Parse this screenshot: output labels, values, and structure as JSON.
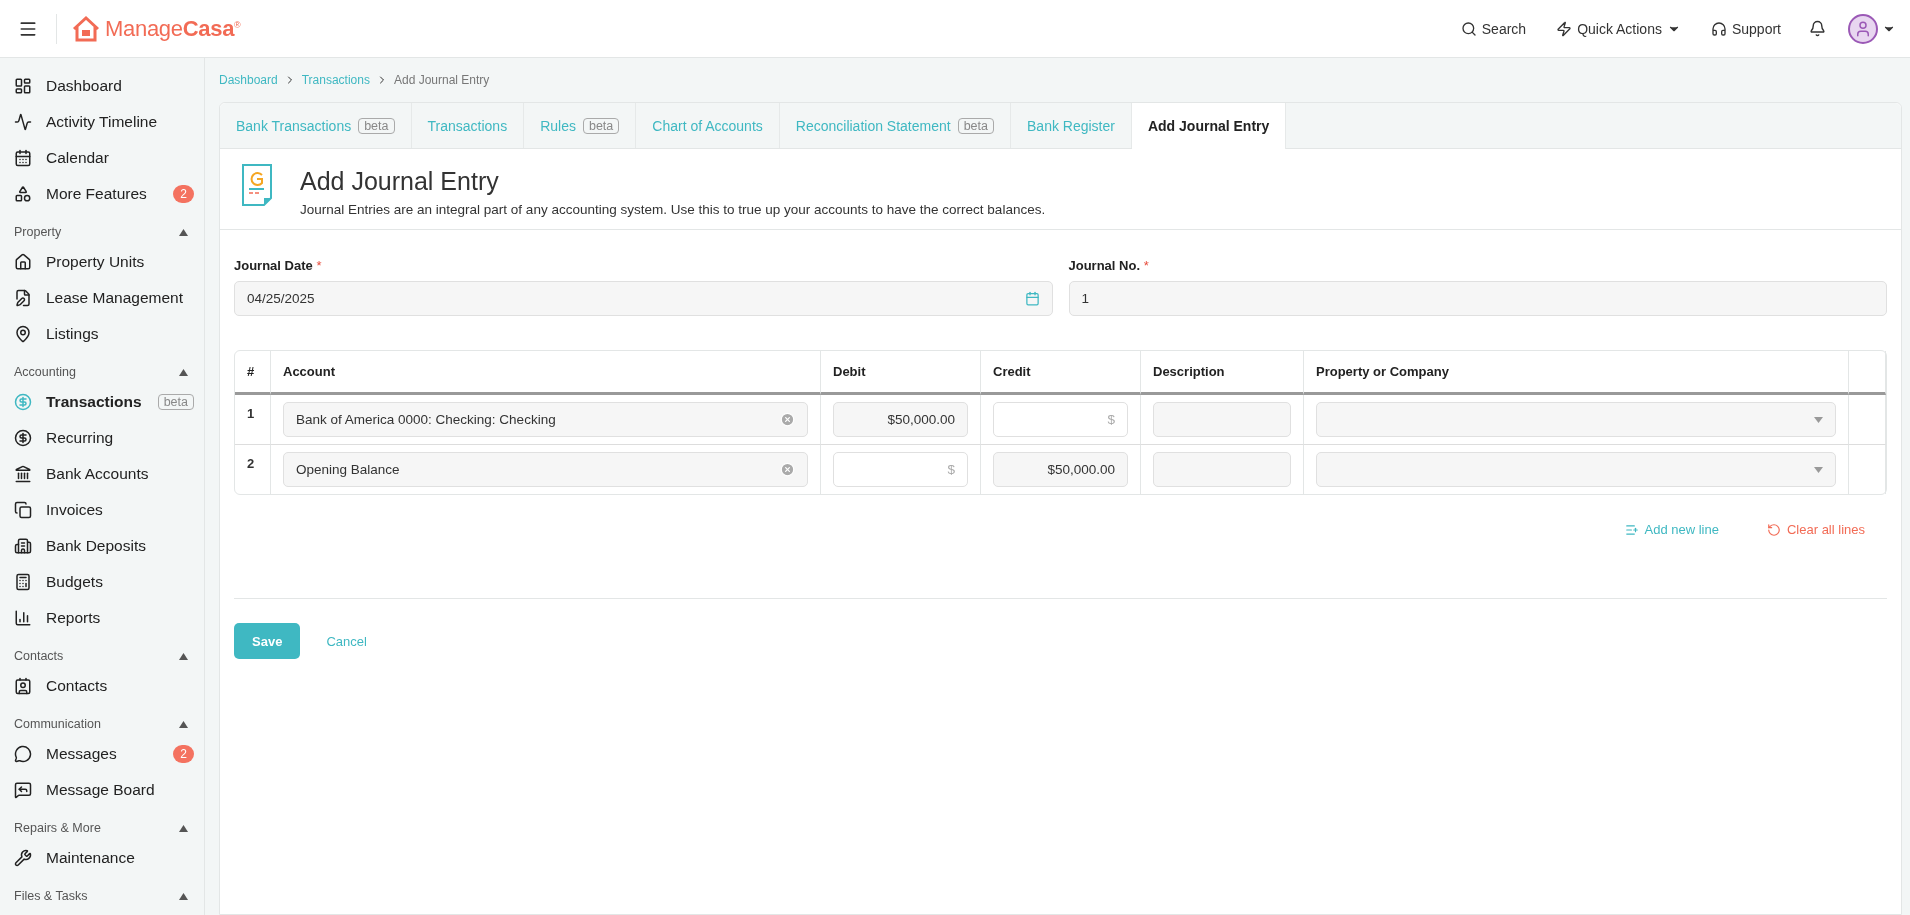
{
  "header": {
    "brand": "Manage**Casa**$^{®}$",
    "actions": [
      {
        "kind": "search",
        "label": "Search"
      },
      {
        "kind": "quick",
        "label": "Quick Actions"
      },
      {
        "kind": "support",
        "label": "Support"
      }
    ]
  },
  "sidebar": {
    "sections": [
      {
        "items": [
          {
            "label": "Dashboard",
            "selected": false
          },
          {
            "label": "Activity Timeline",
            "selected": false
          },
          {
            "label": "Calendar",
            "selected": false
          },
          {
            "label": "More Features",
            "badge": "2",
            "selected": false
          }
        ]
      },
      {
        "title": "Property",
        "expanded": true,
        "items": [
          {
            "label": "Property Units",
            "selected": false
          },
          {
            "label": "Lease Management",
            "selected": false
          },
          {
            "label": "Listings",
            "selected": false
          }
        ]
      },
      {
        "title": "Accounting",
        "expanded": true,
        "items": [
          {
            "label": "Transactions",
            "tag": "beta",
            "selected": true
          },
          {
            "label": "Recurring",
            "selected": false
          },
          {
            "label": "Bank Accounts",
            "selected": false
          },
          {
            "label": "Invoices",
            "selected": false
          },
          {
            "label": "Bank Deposits",
            "selected": false
          },
          {
            "label": "Budgets",
            "selected": false
          },
          {
            "label": "Reports",
            "selected": false
          }
        ]
      },
      {
        "title": "Contacts",
        "expanded": true,
        "items": [
          {
            "label": "Contacts",
            "selected": false
          }
        ]
      },
      {
        "title": "Communication",
        "expanded": true,
        "items": [
          {
            "label": "Messages",
            "badge": "2",
            "selected": false
          },
          {
            "label": "Message Board",
            "selected": false
          }
        ]
      },
      {
        "title": "Repairs & More",
        "expanded": true,
        "items": [
          {
            "label": "Maintenance",
            "selected": false
          }
        ]
      },
      {
        "title": "Files & Tasks",
        "expanded": true
      }
    ]
  },
  "breadcrumb": [
    "Dashboard",
    "Transactions",
    "Add Journal Entry"
  ],
  "tabs": [
    {
      "label": "Bank Transactions",
      "tag": "beta",
      "selected": false
    },
    {
      "label": "Transactions",
      "selected": false
    },
    {
      "label": "Rules",
      "tag": "beta",
      "selected": false
    },
    {
      "label": "Chart of Accounts",
      "selected": false
    },
    {
      "label": "Reconciliation Statement",
      "tag": "beta",
      "selected": false
    },
    {
      "label": "Bank Register",
      "selected": false
    },
    {
      "label": "Add Journal Entry",
      "selected": true
    }
  ],
  "page": {
    "title": "Add Journal Entry",
    "subtitle": "Journal Entries are an integral part of any accounting system. Use this to true up your accounts to have the correct balances."
  },
  "form": {
    "date": {
      "label": "Journal Date",
      "required_mark": "*",
      "value": "04/25/2025"
    },
    "number": {
      "label": "Journal No.",
      "required_mark": "*",
      "value": "1"
    }
  },
  "table": {
    "columns": [
      "#",
      "Account",
      "Debit",
      "Credit",
      "Description",
      "Property or Company"
    ],
    "rows": [
      {
        "number": "1",
        "account": "Bank of America 0000: Checking: Checking",
        "debit": {
          "value": "$50,000.00"
        },
        "credit": {
          "placeholder": "$"
        }
      },
      {
        "number": "2",
        "account": "Opening Balance",
        "debit": {
          "placeholder": "$"
        },
        "credit": {
          "value": "$50,000.00"
        }
      }
    ]
  },
  "line_actions": [
    {
      "kind": "add",
      "label": "Add new line"
    },
    {
      "kind": "clear",
      "label": "Clear all lines"
    }
  ],
  "buttons": [
    {
      "kind": "primary",
      "label": "Save"
    },
    {
      "kind": "link",
      "label": "Cancel"
    }
  ]
}
